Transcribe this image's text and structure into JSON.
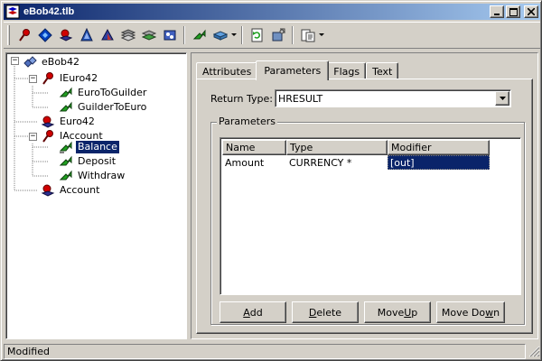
{
  "window": {
    "title": "eBob42.tlb",
    "minimize_label": "_",
    "maximize_label": "□",
    "close_label": "✕"
  },
  "toolbar": {
    "icons": [
      "new-interface-icon",
      "new-dispinterface-icon",
      "new-coclass-icon",
      "new-enum-icon",
      "new-alias-icon",
      "new-record-icon",
      "new-union-icon",
      "new-module-icon",
      "new-method-icon",
      "new-property-icon",
      "refresh-icon",
      "register-icon",
      "export-icon"
    ]
  },
  "tree": {
    "expander_minus": "−",
    "items": [
      {
        "label": "eBob42",
        "icon": "library-icon",
        "level": 0
      },
      {
        "label": "IEuro42",
        "icon": "interface-icon",
        "level": 1
      },
      {
        "label": "EuroToGuilder",
        "icon": "method-icon",
        "level": 2
      },
      {
        "label": "GuilderToEuro",
        "icon": "method-icon",
        "level": 2
      },
      {
        "label": "Euro42",
        "icon": "coclass-icon",
        "level": 1
      },
      {
        "label": "IAccount",
        "icon": "interface-icon",
        "level": 1
      },
      {
        "label": "Balance",
        "icon": "property-icon",
        "level": 2,
        "selected": true
      },
      {
        "label": "Deposit",
        "icon": "method-icon",
        "level": 2
      },
      {
        "label": "Withdraw",
        "icon": "method-icon",
        "level": 2
      },
      {
        "label": "Account",
        "icon": "coclass-icon",
        "level": 1
      }
    ]
  },
  "tabs": [
    {
      "label": "Attributes",
      "active": false
    },
    {
      "label": "Parameters",
      "active": true
    },
    {
      "label": "Flags",
      "active": false
    },
    {
      "label": "Text",
      "active": false
    }
  ],
  "return_type": {
    "label": "Return Type:",
    "value": "HRESULT"
  },
  "parameters": {
    "group_label": "Parameters",
    "columns": [
      "Name",
      "Type",
      "Modifier"
    ],
    "rows": [
      {
        "name": "Amount",
        "type": "CURRENCY *",
        "modifier": "[out]"
      }
    ]
  },
  "buttons": {
    "add": {
      "pre": "",
      "u": "A",
      "post": "dd"
    },
    "delete": {
      "pre": "",
      "u": "D",
      "post": "elete"
    },
    "move_up": {
      "pre": "Move ",
      "u": "U",
      "post": "p"
    },
    "move_down": {
      "pre": "Move Do",
      "u": "w",
      "post": "n"
    }
  },
  "status": {
    "text": "Modified"
  },
  "colors": {
    "face": "#d4d0c8",
    "title_start": "#0a246a",
    "title_end": "#a6caf0",
    "selection": "#0a246a"
  }
}
